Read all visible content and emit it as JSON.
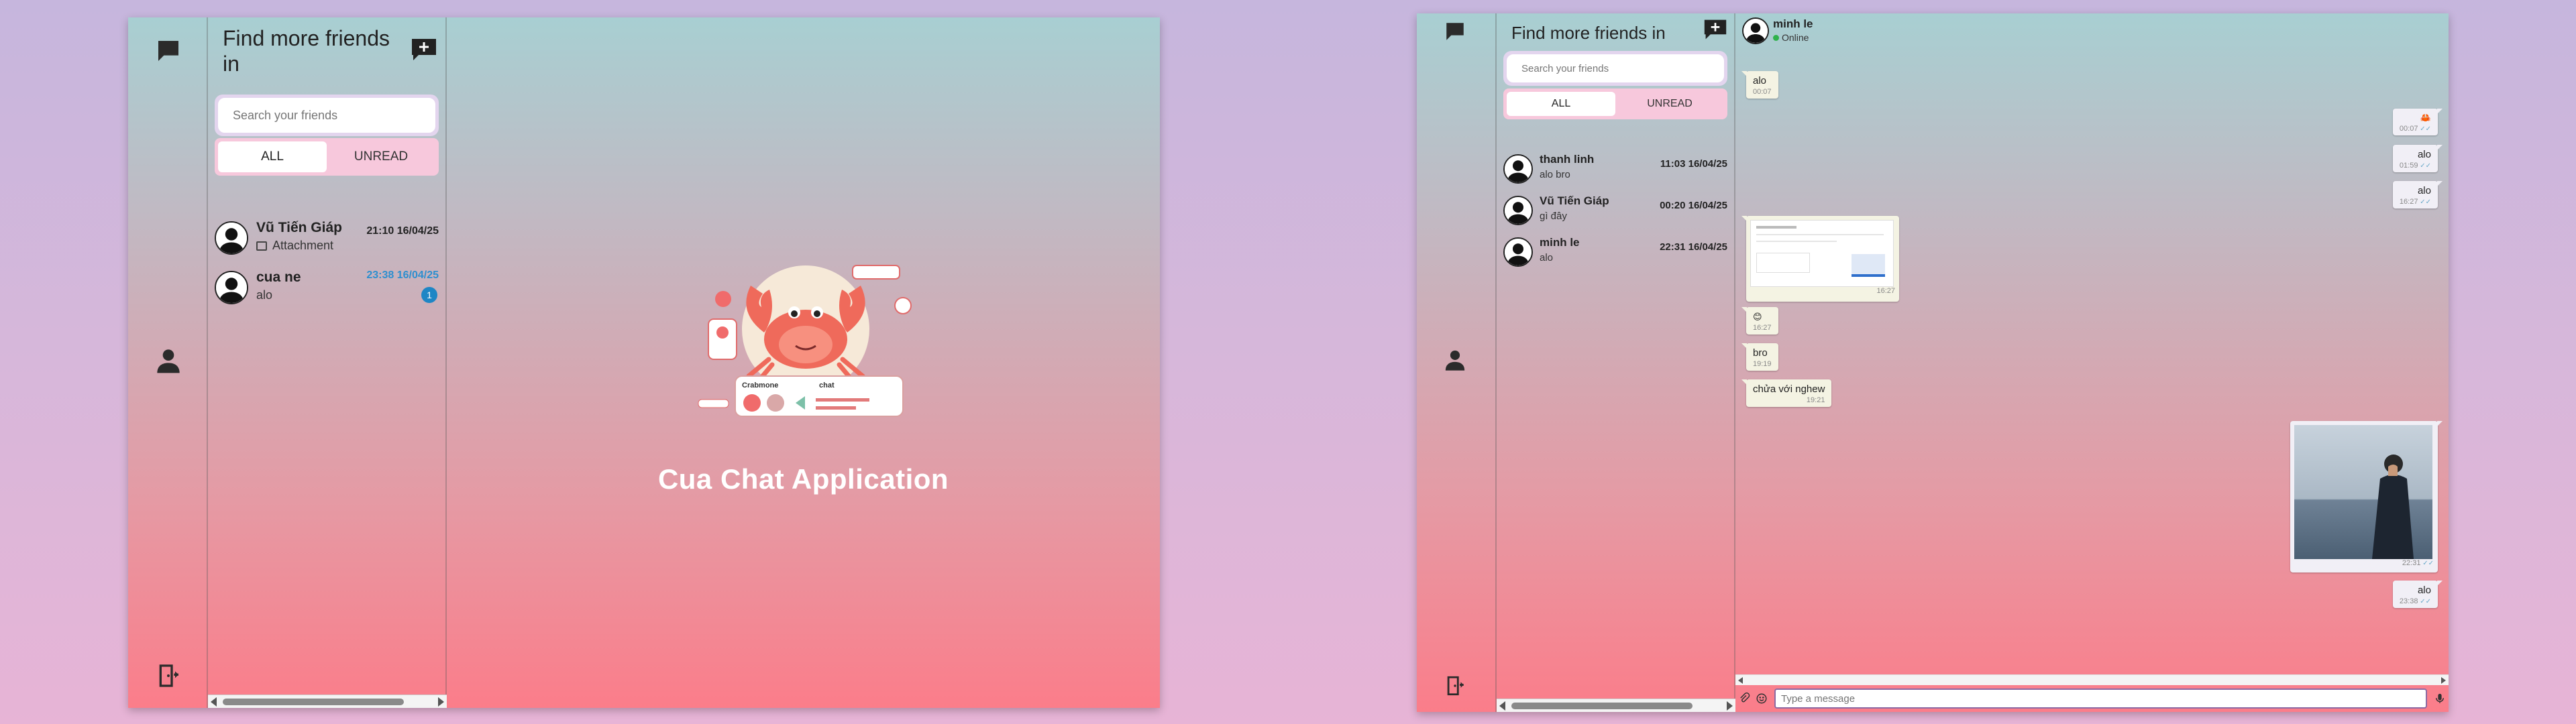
{
  "colors": {
    "accent_blue": "#2e8fcf",
    "online_green": "#2fb24c",
    "badge_blue": "#1e86c5",
    "tab_unread_bg": "#f7c8dc",
    "gradient_top": "#a8cfd2",
    "gradient_bottom": "#fb7d8a"
  },
  "left_window": {
    "rail": {
      "icons": [
        "chat-icon",
        "contacts-icon",
        "logout-icon"
      ]
    },
    "panel": {
      "title": "Find more friends in",
      "add_icon": "add-chat-icon",
      "search_placeholder": "Search your friends",
      "tabs": [
        {
          "label": "ALL",
          "active": true
        },
        {
          "label": "UNREAD",
          "active": false
        }
      ],
      "conversations": [
        {
          "name": "Vũ Tiến Giáp",
          "preview": "Attachment",
          "preview_icon": "image-icon",
          "time": "21:10 16/04/25",
          "unread": false
        },
        {
          "name": "cua ne",
          "preview": "alo",
          "time": "23:38 16/04/25",
          "unread": true,
          "badge": "1"
        }
      ]
    },
    "welcome": {
      "title": "Cua Chat Application",
      "illustration_labels": {
        "left": "Crabmone",
        "right": "chat"
      }
    }
  },
  "right_window": {
    "rail": {
      "icons": [
        "chat-icon",
        "contacts-icon",
        "logout-icon"
      ]
    },
    "panel": {
      "title": "Find more friends in",
      "add_icon": "add-chat-icon",
      "search_placeholder": "Search your friends",
      "tabs": [
        {
          "label": "ALL",
          "active": true
        },
        {
          "label": "UNREAD",
          "active": false
        }
      ],
      "conversations": [
        {
          "name": "thanh linh",
          "preview": "alo bro",
          "time": "11:03 16/04/25"
        },
        {
          "name": "Vũ Tiến Giáp",
          "preview": "gì đây",
          "time": "00:20 16/04/25"
        },
        {
          "name": "minh le",
          "preview": "alo",
          "time": "22:31 16/04/25"
        }
      ]
    },
    "chat": {
      "user": "minh le",
      "status": "Online",
      "messages": [
        {
          "dir": "in",
          "text": "alo",
          "time": "00:07"
        },
        {
          "dir": "out",
          "text": "🦀",
          "time": "00:07"
        },
        {
          "dir": "out",
          "text": "alo",
          "time": "01:59"
        },
        {
          "dir": "out",
          "text": "alo",
          "time": "16:27"
        },
        {
          "dir": "in",
          "type": "image",
          "alt": "screenshot-thumbnail",
          "time": "16:27"
        },
        {
          "dir": "in",
          "text": "😊",
          "time": "16:27"
        },
        {
          "dir": "in",
          "text": "bro",
          "time": "19:19"
        },
        {
          "dir": "in",
          "text": "chửa với nghew",
          "time": "19:21"
        },
        {
          "dir": "out",
          "type": "image",
          "alt": "person-photo",
          "time": "22:31"
        },
        {
          "dir": "out",
          "text": "alo",
          "time": "23:38"
        }
      ],
      "composer": {
        "placeholder": "Type a message",
        "icons": [
          "attach-icon",
          "emoji-icon",
          "mic-icon"
        ]
      }
    }
  }
}
